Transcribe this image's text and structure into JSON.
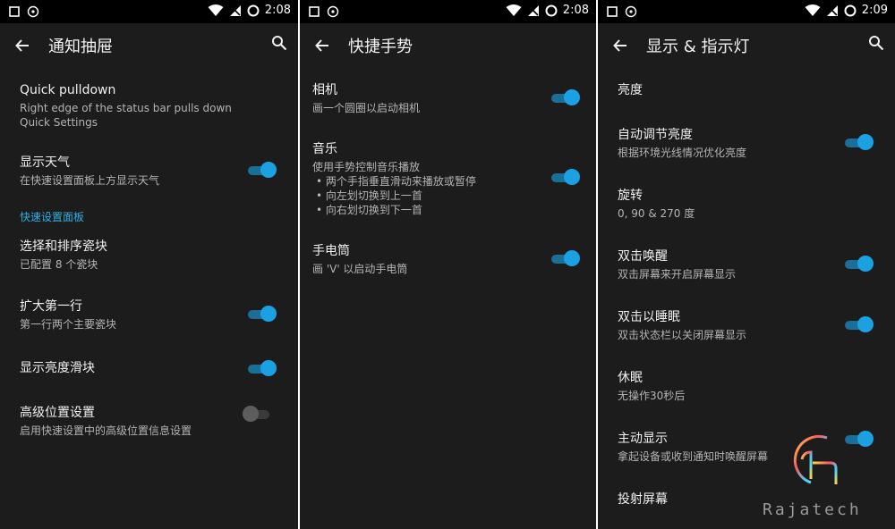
{
  "status": [
    {
      "time": "2:08"
    },
    {
      "time": "2:08"
    },
    {
      "time": "2:09"
    }
  ],
  "screens": [
    {
      "title": "通知抽屉",
      "has_search": true,
      "items": [
        {
          "title": "Quick pulldown",
          "summary": "Right edge of the status bar pulls down Quick Settings",
          "toggle": null
        },
        {
          "title": "显示天气",
          "summary": "在快速设置面板上方显示天气",
          "toggle": "on"
        },
        {
          "category": "快速设置面板"
        },
        {
          "title": "选择和排序瓷块",
          "summary": "已配置 8 个瓷块",
          "toggle": null
        },
        {
          "title": "扩大第一行",
          "summary": "第一行两个主要瓷块",
          "toggle": "on"
        },
        {
          "title": "显示亮度滑块",
          "summary": "",
          "toggle": "on"
        },
        {
          "title": "高级位置设置",
          "summary": "启用快速设置中的高级位置信息设置",
          "toggle": "off"
        }
      ]
    },
    {
      "title": "快捷手势",
      "has_search": false,
      "items": [
        {
          "title": "相机",
          "summary": "画一个圆圈以启动相机",
          "toggle": "on"
        },
        {
          "title": "音乐",
          "summary": "使用手势控制音乐播放",
          "bullets": [
            "• 两个手指垂直滑动来播放或暂停",
            "• 向左划切换到上一首",
            "• 向右划切换到下一首"
          ],
          "toggle": "on"
        },
        {
          "title": "手电筒",
          "summary": "画 'V' 以启动手电筒",
          "toggle": "on"
        }
      ]
    },
    {
      "title": "显示 & 指示灯",
      "has_search": true,
      "items": [
        {
          "title": "亮度",
          "summary": "",
          "toggle": null
        },
        {
          "title": "自动调节亮度",
          "summary": "根据环境光线情况优化亮度",
          "toggle": "on"
        },
        {
          "title": "旋转",
          "summary": "0, 90 & 270 度",
          "toggle": null
        },
        {
          "title": "双击唤醒",
          "summary": "双击屏幕来开启屏幕显示",
          "toggle": "on"
        },
        {
          "title": "双击以睡眠",
          "summary": "双击状态栏以关闭屏幕显示",
          "toggle": "on"
        },
        {
          "title": "休眠",
          "summary": "无操作30秒后",
          "toggle": null
        },
        {
          "title": "主动显示",
          "summary": "拿起设备或收到通知时唤醒屏幕",
          "toggle": "on"
        },
        {
          "title": "投射屏幕",
          "summary": "",
          "toggle": null
        }
      ]
    }
  ],
  "watermark": "Rajatech",
  "colors": {
    "accent": "#1ba1e2",
    "background": "#1c1c1c",
    "category": "#2fb1e6"
  }
}
